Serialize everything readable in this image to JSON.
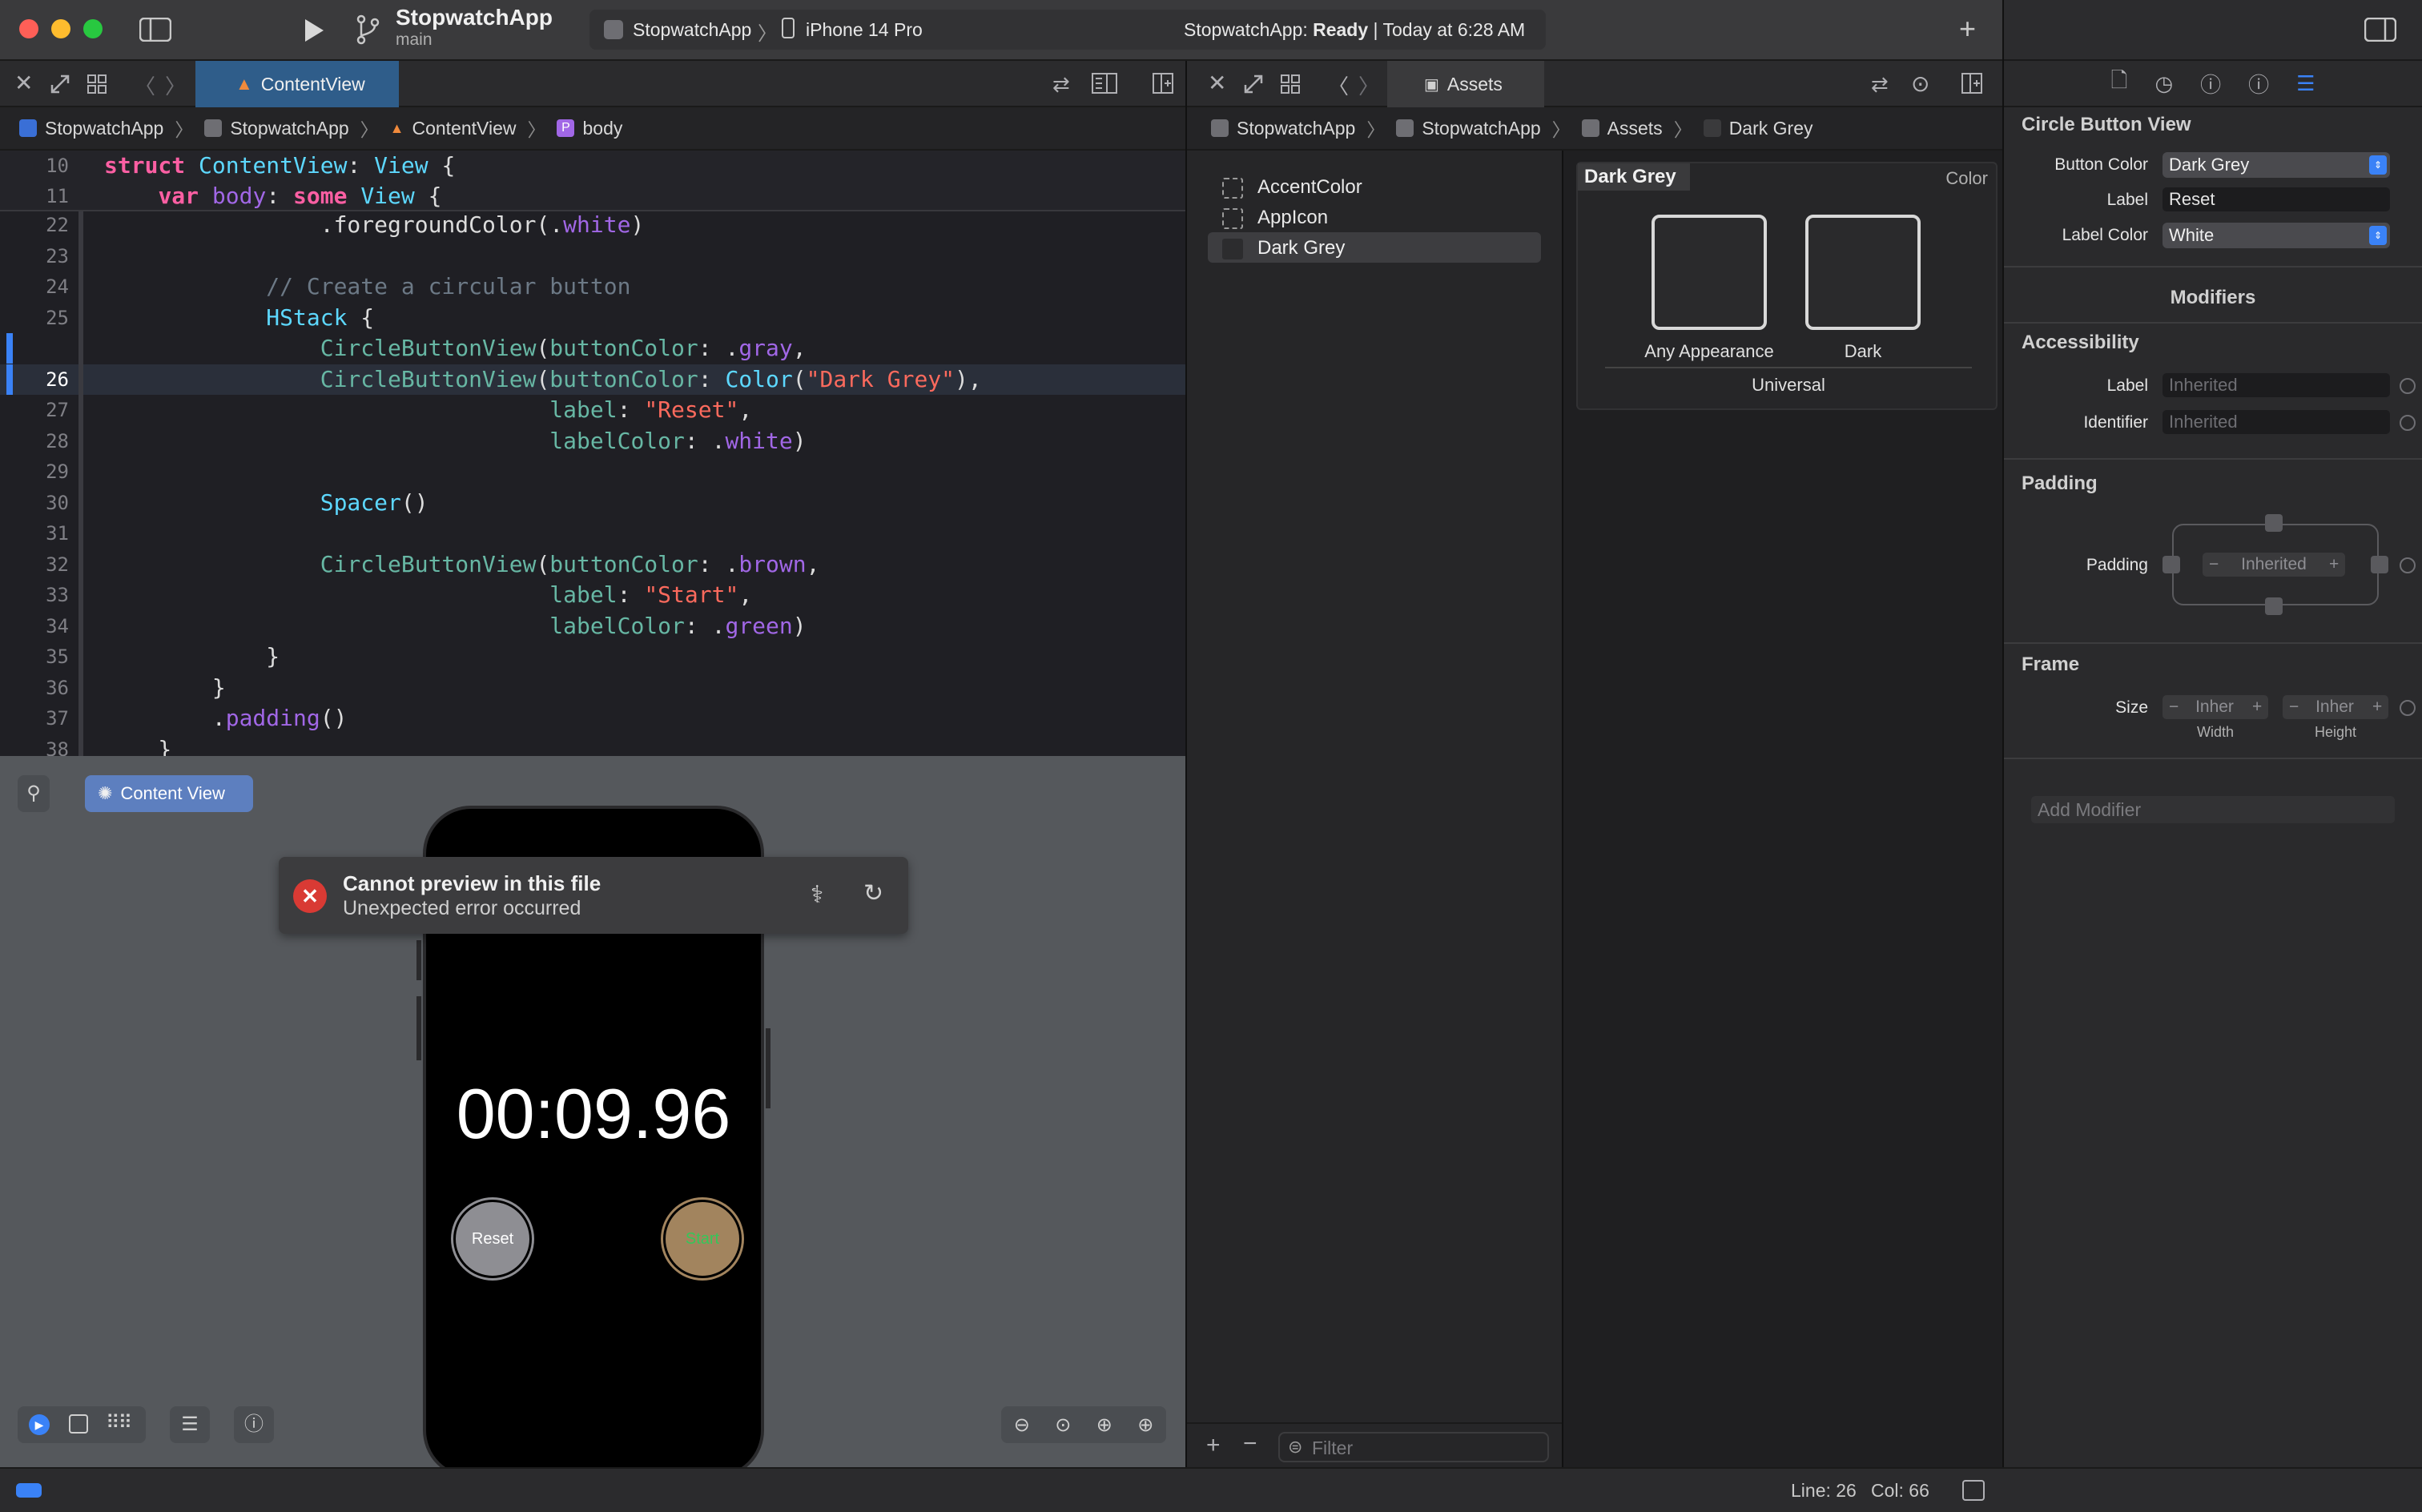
{
  "window": {
    "project_name": "StopwatchApp",
    "branch": "main",
    "scheme": "StopwatchApp",
    "device": "iPhone 14 Pro",
    "status_app": "StopwatchApp:",
    "status_state": "Ready",
    "status_time": "| Today at 6:28 AM"
  },
  "editor": {
    "tab_label": "ContentView",
    "breadcrumb": [
      "StopwatchApp",
      "StopwatchApp",
      "ContentView",
      "body"
    ],
    "sticky_lines": [
      {
        "num": "10",
        "tokens": [
          [
            "kw",
            "struct "
          ],
          [
            "ty",
            "ContentView"
          ],
          [
            "pl",
            ": "
          ],
          [
            "ty",
            "View"
          ],
          [
            "pl",
            " {"
          ]
        ]
      },
      {
        "num": "11",
        "tokens": [
          [
            "pl",
            "    "
          ],
          [
            "kw",
            "var "
          ],
          [
            "mem",
            "body"
          ],
          [
            "pl",
            ": "
          ],
          [
            "kw",
            "some "
          ],
          [
            "ty",
            "View"
          ],
          [
            "pl",
            " {"
          ]
        ]
      }
    ],
    "lines": [
      {
        "num": "22",
        "tokens": [
          [
            "pl",
            "                .foregroundColor(."
          ],
          [
            "mem",
            "white"
          ],
          [
            "pl",
            ")"
          ]
        ]
      },
      {
        "num": "23",
        "tokens": [
          [
            "pl",
            ""
          ]
        ]
      },
      {
        "num": "24",
        "tokens": [
          [
            "cm",
            "            // Create a circular button"
          ]
        ]
      },
      {
        "num": "25",
        "tokens": [
          [
            "pl",
            "            "
          ],
          [
            "ty",
            "HStack"
          ],
          [
            "pl",
            " {"
          ]
        ]
      },
      {
        "num": "",
        "tokens": [
          [
            "pl",
            "                "
          ],
          [
            "fn",
            "CircleButtonView"
          ],
          [
            "pl",
            "("
          ],
          [
            "fn",
            "buttonColor"
          ],
          [
            "pl",
            ": ."
          ],
          [
            "mem",
            "gray"
          ],
          [
            "pl",
            ","
          ]
        ]
      },
      {
        "num": "26",
        "tokens": [
          [
            "pl",
            "                "
          ],
          [
            "fn",
            "CircleButtonView"
          ],
          [
            "pl",
            "("
          ],
          [
            "fn",
            "buttonColor"
          ],
          [
            "pl",
            ": "
          ],
          [
            "ty",
            "Color"
          ],
          [
            "pl",
            "("
          ],
          [
            "str",
            "\"Dark Grey\""
          ],
          [
            "pl",
            "),"
          ]
        ]
      },
      {
        "num": "27",
        "tokens": [
          [
            "pl",
            "                                 "
          ],
          [
            "fn",
            "label"
          ],
          [
            "pl",
            ": "
          ],
          [
            "str",
            "\"Reset\""
          ],
          [
            "pl",
            ","
          ]
        ]
      },
      {
        "num": "28",
        "tokens": [
          [
            "pl",
            "                                 "
          ],
          [
            "fn",
            "labelColor"
          ],
          [
            "pl",
            ": ."
          ],
          [
            "mem",
            "white"
          ],
          [
            "pl",
            ")"
          ]
        ]
      },
      {
        "num": "29",
        "tokens": [
          [
            "pl",
            ""
          ]
        ]
      },
      {
        "num": "30",
        "tokens": [
          [
            "pl",
            "                "
          ],
          [
            "ty",
            "Spacer"
          ],
          [
            "pl",
            "()"
          ]
        ]
      },
      {
        "num": "31",
        "tokens": [
          [
            "pl",
            ""
          ]
        ]
      },
      {
        "num": "32",
        "tokens": [
          [
            "pl",
            "                "
          ],
          [
            "fn",
            "CircleButtonView"
          ],
          [
            "pl",
            "("
          ],
          [
            "fn",
            "buttonColor"
          ],
          [
            "pl",
            ": ."
          ],
          [
            "mem",
            "brown"
          ],
          [
            "pl",
            ","
          ]
        ]
      },
      {
        "num": "33",
        "tokens": [
          [
            "pl",
            "                                 "
          ],
          [
            "fn",
            "label"
          ],
          [
            "pl",
            ": "
          ],
          [
            "str",
            "\"Start\""
          ],
          [
            "pl",
            ","
          ]
        ]
      },
      {
        "num": "34",
        "tokens": [
          [
            "pl",
            "                                 "
          ],
          [
            "fn",
            "labelColor"
          ],
          [
            "pl",
            ": ."
          ],
          [
            "mem",
            "green"
          ],
          [
            "pl",
            ")"
          ]
        ]
      },
      {
        "num": "35",
        "tokens": [
          [
            "pl",
            "            }"
          ]
        ]
      },
      {
        "num": "36",
        "tokens": [
          [
            "pl",
            "        }"
          ]
        ]
      },
      {
        "num": "37",
        "tokens": [
          [
            "pl",
            "        ."
          ],
          [
            "mem",
            "padding"
          ],
          [
            "pl",
            "()"
          ]
        ]
      },
      {
        "num": "38",
        "tokens": [
          [
            "pl",
            "    }"
          ]
        ]
      }
    ]
  },
  "preview": {
    "pill_label": "Content View",
    "error_title": "Cannot preview in this file",
    "error_subtitle": "Unexpected error occurred",
    "timer": "00:09.96",
    "reset_label": "Reset",
    "start_label": "Start"
  },
  "assets": {
    "tab_label": "Assets",
    "breadcrumb": [
      "StopwatchApp",
      "StopwatchApp",
      "Assets",
      "Dark Grey"
    ],
    "items": [
      "AccentColor",
      "AppIcon",
      "Dark Grey"
    ],
    "selected": "Dark Grey",
    "set_title": "Dark Grey",
    "set_type": "Color",
    "wells": [
      "Any Appearance",
      "Dark"
    ],
    "group_label": "Universal",
    "filter_placeholder": "Filter"
  },
  "inspector": {
    "title": "Circle Button View",
    "button_color_label": "Button Color",
    "button_color_value": "Dark Grey",
    "label_label": "Label",
    "label_value": "Reset",
    "label_color_label": "Label Color",
    "label_color_value": "White",
    "modifiers_header": "Modifiers",
    "accessibility_header": "Accessibility",
    "acc_label_label": "Label",
    "acc_label_placeholder": "Inherited",
    "acc_identifier_label": "Identifier",
    "acc_identifier_placeholder": "Inherited",
    "padding_header": "Padding",
    "padding_label": "Padding",
    "padding_value": "Inherited",
    "frame_header": "Frame",
    "size_label": "Size",
    "width_value": "Inher",
    "height_value": "Inher",
    "width_caption": "Width",
    "height_caption": "Height",
    "add_modifier_placeholder": "Add Modifier"
  },
  "status": {
    "line": "Line: 26",
    "col": "Col: 66"
  },
  "colors": {
    "accent": "#2f6ad9",
    "error": "#d93a34",
    "brown_button": "#a2845e",
    "gray_button": "#8e8e93"
  }
}
